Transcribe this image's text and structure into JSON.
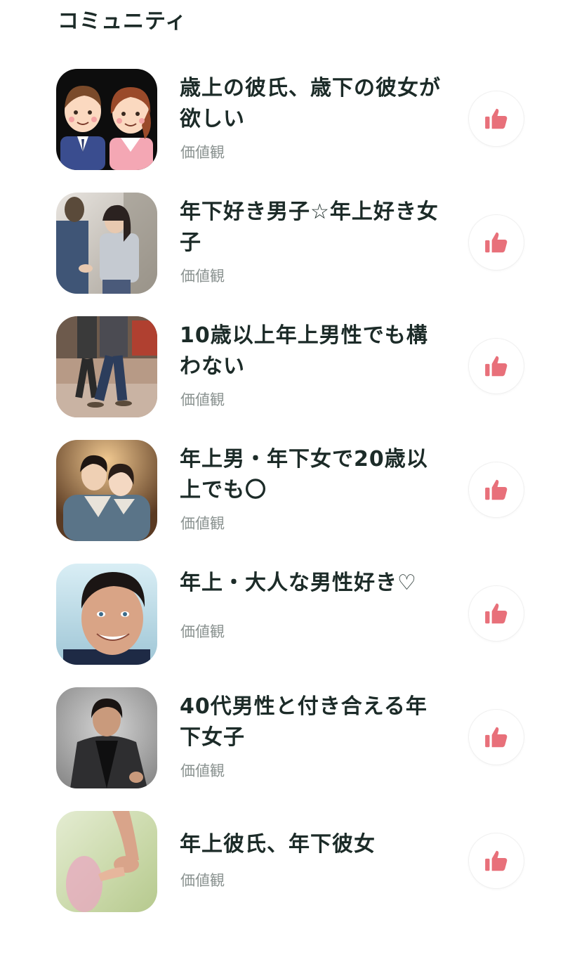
{
  "header": {
    "title": "コミュニティ"
  },
  "communities": [
    {
      "name": "歳上の彼氏、歳下の彼女が欲しい",
      "category": "価値観",
      "thumb_icon": "couple-cartoon-image"
    },
    {
      "name": "年下好き男子☆年上好き女子",
      "category": "価値観",
      "thumb_icon": "couple-holding-hands-photo"
    },
    {
      "name": "10歳以上年上男性でも構わない",
      "category": "価値観",
      "thumb_icon": "walking-couple-photo"
    },
    {
      "name": "年上男・年下女で20歳以上でも〇",
      "category": "価値観",
      "thumb_icon": "couple-kimono-photo"
    },
    {
      "name": "年上・大人な男性好き♡",
      "category": "価値観",
      "thumb_icon": "smiling-man-photo"
    },
    {
      "name": "40代男性と付き合える年下女子",
      "category": "価値観",
      "thumb_icon": "man-in-suit-photo"
    },
    {
      "name": "年上彼氏、年下彼女",
      "category": "価値観",
      "thumb_icon": "holding-hands-blur-photo"
    }
  ],
  "like_icon": "thumbs-up-icon",
  "colors": {
    "accent": "#e8707a",
    "title": "#1c2b28",
    "category": "#8a9290"
  }
}
